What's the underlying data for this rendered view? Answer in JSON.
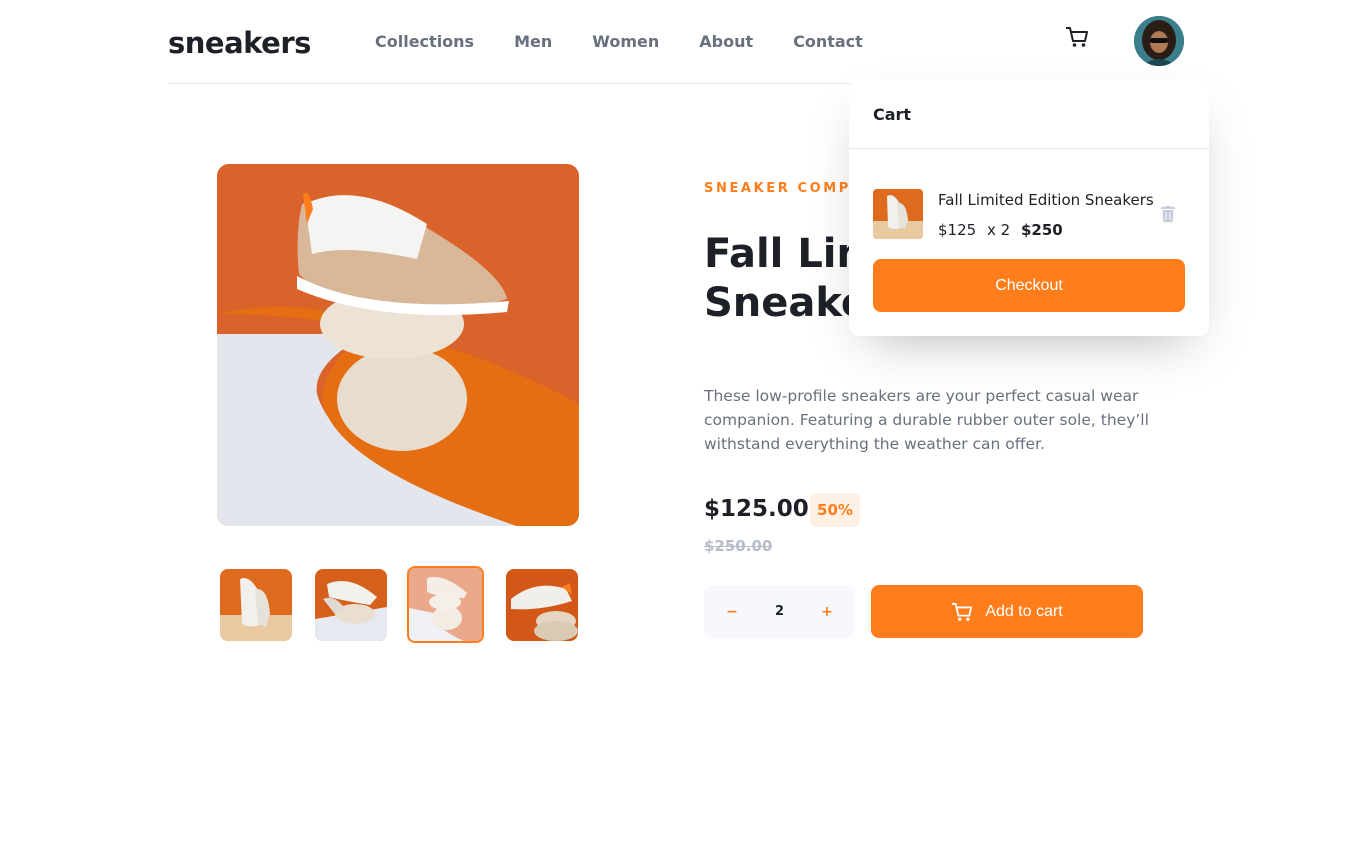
{
  "header": {
    "logo": "sneakers",
    "nav": [
      "Collections",
      "Men",
      "Women",
      "About",
      "Contact"
    ]
  },
  "product": {
    "company": "SNEAKER COMPANY",
    "title": "Fall Limited Edition Sneakers",
    "description": "These low-profile sneakers are your perfect casual wear companion. Featuring a durable rubber outer sole, they’ll withstand everything the weather can offer.",
    "price": "$125.00",
    "discount": "50%",
    "old_price": "$250.00",
    "quantity": "2",
    "minus": "−",
    "plus": "+",
    "add_to_cart": "Add to cart"
  },
  "gallery": {
    "thumbnails": [
      "thumbnail-1",
      "thumbnail-2",
      "thumbnail-3",
      "thumbnail-4"
    ],
    "active_index": 2
  },
  "cart": {
    "heading": "Cart",
    "item_name": "Fall Limited Edition Sneakers",
    "item_price": "$125",
    "item_qty": "x 2",
    "item_total": "$250",
    "checkout": "Checkout"
  },
  "colors": {
    "accent": "#ff7e1b",
    "accent_pale": "#fff0e6",
    "text_dark": "#1d2026",
    "text_grey": "#69707d"
  },
  "icons": [
    "cart-icon",
    "avatar",
    "trash-icon",
    "cart-button-icon"
  ]
}
